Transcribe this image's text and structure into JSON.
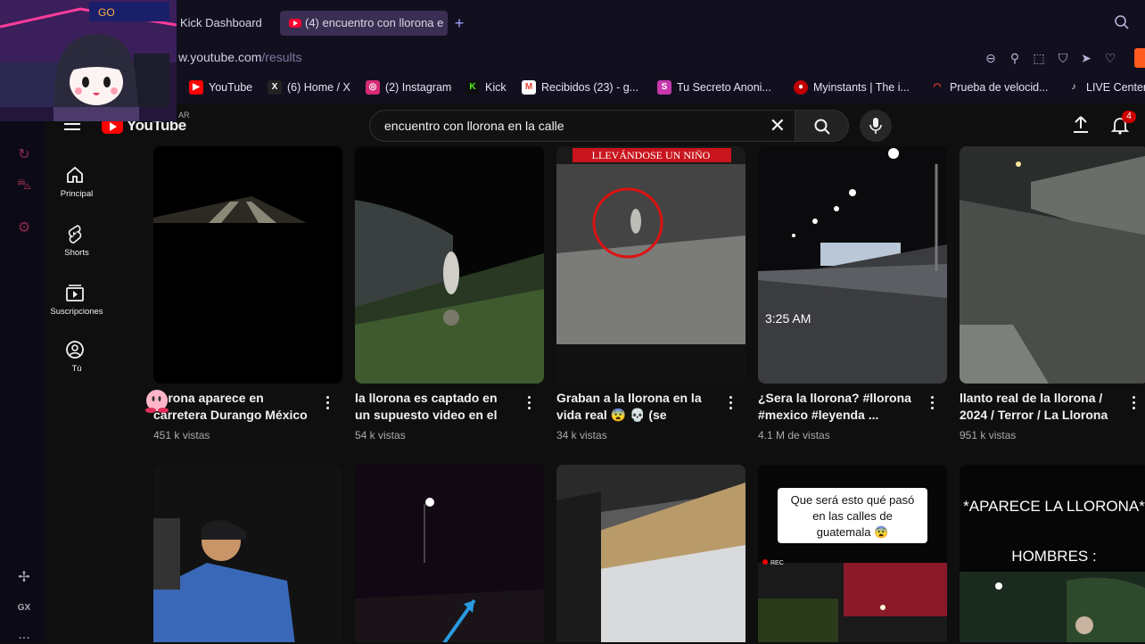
{
  "browser": {
    "tabs": [
      {
        "label": "Kick Dashboard",
        "active": false
      },
      {
        "label": "(4) encuentro con llorona e",
        "active": true
      }
    ],
    "new_tab": "+",
    "url_prefix": "w.youtube.com",
    "url_path": "/results",
    "bookmarks": [
      {
        "label": "YouTube",
        "icon": "youtube-icon",
        "color": "#ff0000"
      },
      {
        "label": "(6) Home / X",
        "icon": "x-icon",
        "color": "#000000"
      },
      {
        "label": "(2) Instagram",
        "icon": "instagram-icon",
        "color": "#d62976"
      },
      {
        "label": "Kick",
        "icon": "kick-icon",
        "color": "#53fc18"
      },
      {
        "label": "Recibidos (23) - g...",
        "icon": "gmail-icon",
        "color": "#ea4335"
      },
      {
        "label": "Tu Secreto Anoni...",
        "icon": "secreto-icon",
        "color": "#c837ab"
      },
      {
        "label": "Myinstants | The i...",
        "icon": "myinstants-icon",
        "color": "#c00000"
      },
      {
        "label": "Prueba de velocid...",
        "icon": "speedtest-icon",
        "color": "#ff3b30"
      },
      {
        "label": "LIVE Center",
        "icon": "tiktok-icon",
        "color": "#000000"
      }
    ]
  },
  "youtube": {
    "logo_text": "YouTube",
    "country": "AR",
    "search_query": "encuentro con llorona en la calle",
    "notifications": "4",
    "guide": [
      {
        "label": "Principal",
        "icon": "home-icon"
      },
      {
        "label": "Shorts",
        "icon": "shorts-icon"
      },
      {
        "label": "Suscripciones",
        "icon": "subscriptions-icon"
      },
      {
        "label": "Tú",
        "icon": "you-icon"
      }
    ],
    "results": [
      {
        "title": "llorona aparece en carretera Durango México",
        "views": "451 k vistas"
      },
      {
        "title": "la llorona es captado en un supuesto video en el sur d...",
        "views": "54 k vistas"
      },
      {
        "title": "Graban a la llorona en la vida real 😨 💀 (se estaba...",
        "views": "34 k vistas",
        "thumb_caption": "LLEVÁNDOSE UN NIÑO"
      },
      {
        "title": "¿Sera la llorona? #llorona #mexico #leyenda ...",
        "views": "4.1 M de vistas",
        "thumb_caption": "3:25 AM"
      },
      {
        "title": "llanto real de la llorona / 2024 / Terror / La Llorona",
        "views": "951 k vistas"
      }
    ],
    "results_row2": [
      {
        "thumb_caption": ""
      },
      {
        "thumb_caption": ""
      },
      {
        "thumb_caption": ""
      },
      {
        "thumb_caption": "Que será esto qué pasó en las calles de guatemala 😨",
        "rec": "REC"
      },
      {
        "thumb_caption": "*APARECE LA LLORONA*",
        "thumb_caption2": "HOMBRES :"
      }
    ]
  },
  "sidebar_strip": {
    "gx_label": "GX",
    "more": "..."
  }
}
